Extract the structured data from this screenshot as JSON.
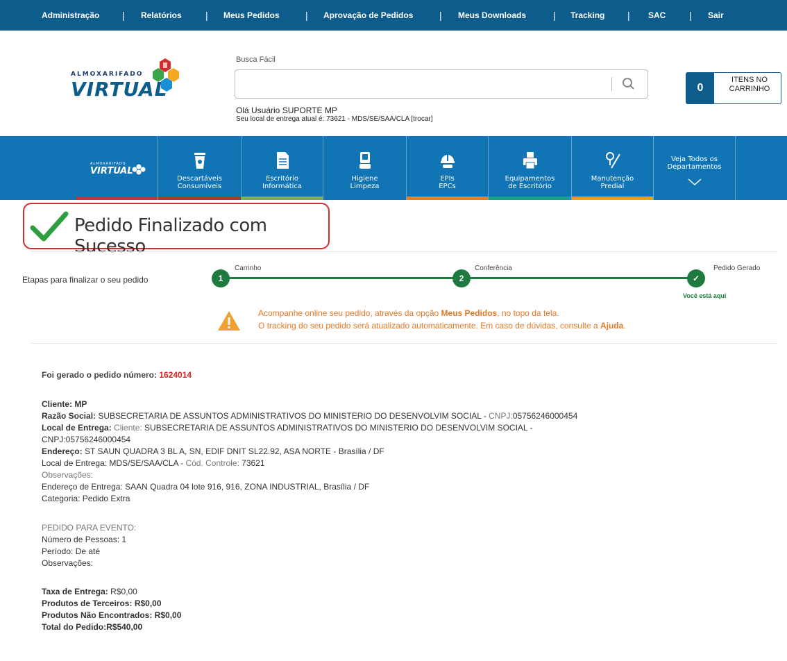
{
  "topnav": {
    "items": [
      "Administração",
      "Relatórios",
      "Meus Pedidos",
      "Aprovação de Pedidos",
      "Meus Downloads",
      "Tracking",
      "SAC",
      "Sair"
    ],
    "separator": "|"
  },
  "logo": {
    "small_text": "ALMOXARIFADO",
    "big_text": "VIRTUAL"
  },
  "search": {
    "label": "Busca Fácil",
    "value": "",
    "placeholder": ""
  },
  "user": {
    "greeting": "Olá Usuário SUPORTE MP",
    "delivery": "Seu local de entrega atual é: 73621 - MDS/SE/SAA/CLA [trocar]"
  },
  "cart": {
    "count": "0",
    "label_line1": "ITENS NO",
    "label_line2": "CARRINHO"
  },
  "departments": [
    {
      "line1": "",
      "line2": "",
      "icon": "virtual-logo-icon",
      "strip": "#c0392b"
    },
    {
      "line1": "Descartáveis",
      "line2": "Consumíveis",
      "icon": "cup-icon",
      "strip": "#b03a2e"
    },
    {
      "line1": "Escritório",
      "line2": "Informática",
      "icon": "document-icon",
      "strip": "#7cb342"
    },
    {
      "line1": "Higiene",
      "line2": "Limpeza",
      "icon": "toilet-icon",
      "strip": "#1175b5"
    },
    {
      "line1": "EPIs",
      "line2": "EPCs",
      "icon": "helmet-icon",
      "strip": "#e67e22"
    },
    {
      "line1": "Equipamentos",
      "line2": "de Escritório",
      "icon": "printer-icon",
      "strip": "#16a085"
    },
    {
      "line1": "Manutenção",
      "line2": "Predial",
      "icon": "tools-icon",
      "strip": "#f39c12"
    },
    {
      "line1": "Veja Todos os",
      "line2": "Departamentos",
      "icon": "chevron-down-icon",
      "strip": "#1175b5"
    }
  ],
  "success": {
    "title": "Pedido Finalizado com Sucesso"
  },
  "progress": {
    "label": "Etapas para finalizar o seu pedido",
    "steps": [
      {
        "number": "1",
        "label": "Carrinho"
      },
      {
        "number": "2",
        "label": "Conferência"
      },
      {
        "number": "✓",
        "label": "Pedido Gerado"
      }
    ],
    "current_marker": "Você está aqui"
  },
  "notice": {
    "line1_pre": "Acompanhe online seu pedido, através da opção ",
    "line1_bold": "Meus Pedidos",
    "line1_post": ", no topo da tela.",
    "line2_pre": "O tracking do seu pedido será atualizado automaticamente. Em caso de dúvidas, consulte a ",
    "line2_bold": "Ajuda",
    "line2_post": "."
  },
  "order": {
    "number_label": "Foi gerado o pedido número: ",
    "number": "1624014",
    "cliente_label": "Cliente: MP",
    "razao_label": "Razão Social:",
    "razao_value": " SUBSECRETARIA DE ASSUNTOS ADMINISTRATIVOS DO MINISTERIO DO DESENVOLVIM SOCIAL - ",
    "cnpj_label": "CNPJ:",
    "cnpj_value": "05756246000454",
    "local_entrega_label": "Local de Entrega:",
    "cliente_word": " Cliente:",
    "local_entrega_value": " SUBSECRETARIA DE ASSUNTOS ADMINISTRATIVOS DO MINISTERIO DO DESENVOLVIM SOCIAL -",
    "local_cnpj": "CNPJ:05756246000454",
    "endereco_label": "Endereço:",
    "endereco_value": " ST SAUN QUADRA 3 BL A, SN, EDIF DNIT SL22.92, ASA NORTE - Brasília / DF",
    "local2_label": "Local de Entrega:",
    "local2_value": " MDS/SE/SAA/CLA - ",
    "controle_label": "Cód. Controle:",
    "controle_value": " 73621",
    "observacoes": "Observações:",
    "end_entrega_label": "Endereço de Entrega:",
    "end_entrega_value": " SAAN Quadra 04 lote 916, 916, ZONA INDUSTRIAL, Brasília / DF",
    "categoria_label": "Categoria:",
    "categoria_value": " Pedido Extra"
  },
  "event": {
    "title": "PEDIDO PARA EVENTO:",
    "pessoas": "Número de Pessoas: 1",
    "periodo": "Período: De até",
    "observacoes": "Observações:"
  },
  "totals": {
    "taxa_label": "Taxa de Entrega:",
    "taxa_value": " R$0,00",
    "terceiros_label": "Produtos de Terceiros:",
    "terceiros_value": " R$0,00",
    "nao_enc_label": "Produtos Não Encontrados:",
    "nao_enc_value": " R$0,00",
    "total_label": "Total do Pedido:",
    "total_value": "R$540,00"
  }
}
